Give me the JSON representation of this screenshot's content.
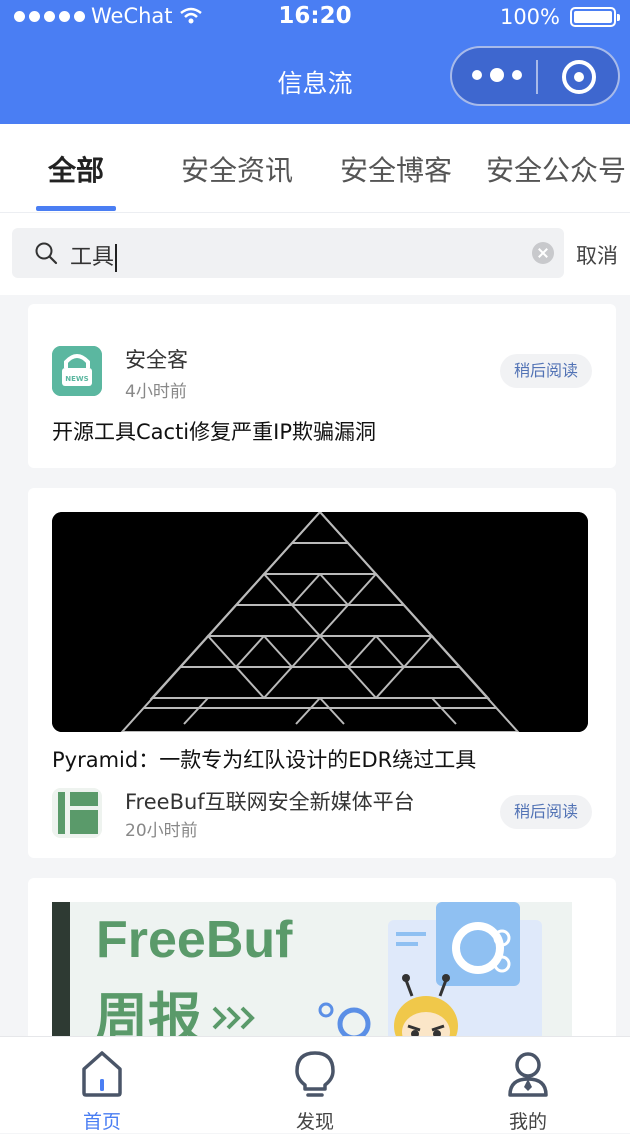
{
  "status_bar": {
    "carrier": "WeChat",
    "time": "16:20",
    "battery": "100%"
  },
  "header": {
    "title": "信息流"
  },
  "tabs": [
    {
      "label": "全部",
      "active": true
    },
    {
      "label": "安全资讯"
    },
    {
      "label": "安全博客"
    },
    {
      "label": "安全公众号"
    }
  ],
  "search": {
    "value": "工具",
    "cancel_label": "取消"
  },
  "feed": [
    {
      "source": "安全客",
      "time": "4小时前",
      "title": "开源工具Cacti修复严重IP欺骗漏洞",
      "read_later": "稍后阅读"
    },
    {
      "source": "FreeBuf互联网安全新媒体平台",
      "time": "20小时前",
      "title": "Pyramid：一款专为红队设计的EDR绕过工具",
      "read_later": "稍后阅读"
    },
    {
      "banner_title": "FreeBuf",
      "banner_subtitle": "周报"
    }
  ],
  "bottom_nav": [
    {
      "label": "首页",
      "icon": "home-icon",
      "active": true
    },
    {
      "label": "发现",
      "icon": "bulb-icon"
    },
    {
      "label": "我的",
      "icon": "user-icon"
    }
  ],
  "colors": {
    "accent": "#4a7ef3",
    "freebuf_green": "#5a9a6a"
  }
}
